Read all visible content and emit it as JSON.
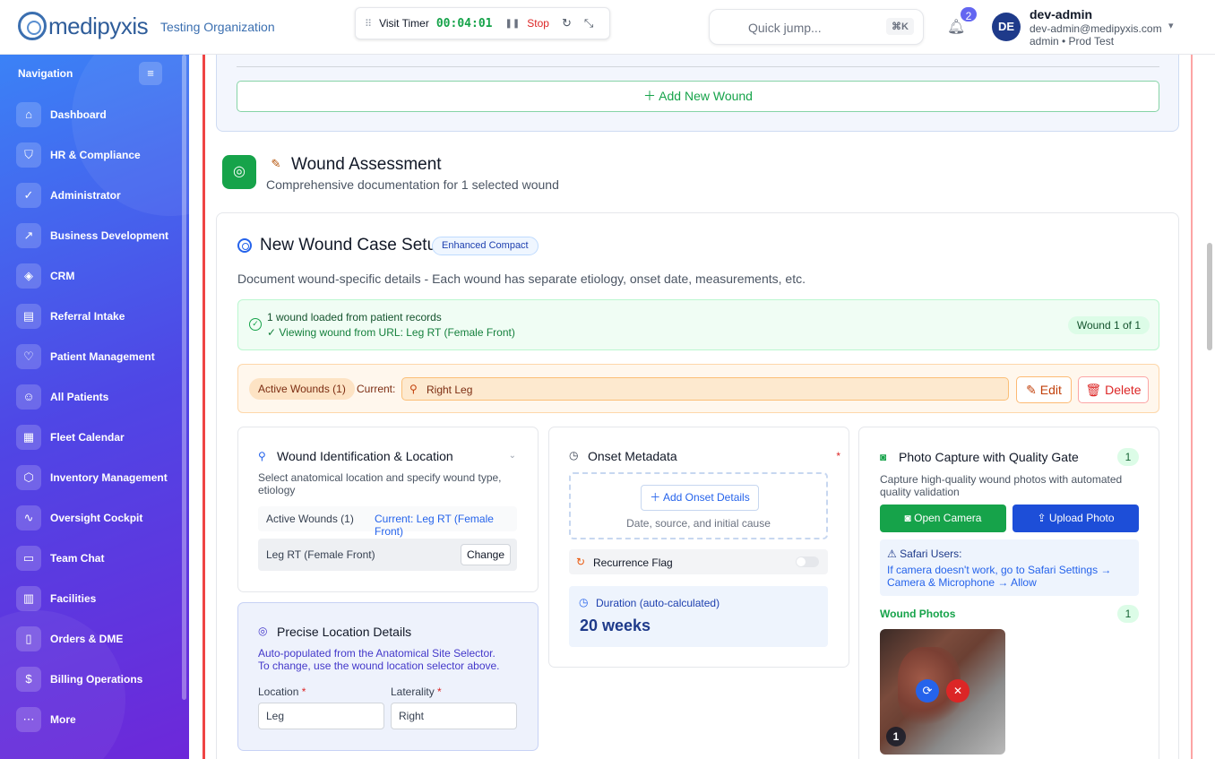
{
  "header": {
    "logo_text": "medipyxis",
    "org_name": "Testing Organization",
    "timer": {
      "label": "Visit Timer",
      "time": "00:04:01",
      "stop_label": "Stop"
    },
    "quick_jump": {
      "placeholder": "Quick jump...",
      "shortcut": "⌘K"
    },
    "notification_count": "2",
    "user": {
      "initials": "DE",
      "name": "dev-admin",
      "email": "dev-admin@medipyxis.com",
      "role": "admin • Prod Test"
    }
  },
  "sidebar": {
    "title": "Navigation",
    "items": [
      {
        "label": "Dashboard",
        "icon": "home-icon"
      },
      {
        "label": "HR & Compliance",
        "icon": "shield-icon"
      },
      {
        "label": "Administrator",
        "icon": "shield-check-icon"
      },
      {
        "label": "Business Development",
        "icon": "trending-up-icon"
      },
      {
        "label": "CRM",
        "icon": "handshake-icon"
      },
      {
        "label": "Referral Intake",
        "icon": "clipboard-icon"
      },
      {
        "label": "Patient Management",
        "icon": "heart-icon"
      },
      {
        "label": "All Patients",
        "icon": "users-icon"
      },
      {
        "label": "Fleet Calendar",
        "icon": "calendar-icon"
      },
      {
        "label": "Inventory Management",
        "icon": "package-icon"
      },
      {
        "label": "Oversight Cockpit",
        "icon": "activity-icon"
      },
      {
        "label": "Team Chat",
        "icon": "message-icon"
      },
      {
        "label": "Facilities",
        "icon": "building-icon"
      },
      {
        "label": "Orders & DME",
        "icon": "document-icon"
      },
      {
        "label": "Billing Operations",
        "icon": "dollar-icon"
      },
      {
        "label": "More",
        "icon": "more-icon"
      }
    ]
  },
  "main": {
    "add_wound_label": "Add New Wound",
    "assessment": {
      "title": "Wound Assessment",
      "subtitle": "Comprehensive documentation for 1 selected wound"
    },
    "case_setup": {
      "title": "New Wound Case Setup",
      "badge": "Enhanced Compact",
      "description": "Document wound-specific details - Each wound has separate etiology, onset date, measurements, etc.",
      "loaded_line1": "1 wound loaded from patient records",
      "loaded_line2": "✓ Viewing wound from URL: Leg RT (Female Front)",
      "wound_of": "Wound 1 of 1",
      "active_chip": "Active Wounds (1)",
      "current_label": "Current:",
      "current_value": "Right Leg",
      "edit_label": "Edit",
      "delete_label": "Delete"
    },
    "identification": {
      "title": "Wound Identification & Location",
      "description": "Select anatomical location and specify wound type, etiology",
      "active_wounds": "Active Wounds (1)",
      "current": "Current: Leg RT (Female Front)",
      "location_text": "Leg RT (Female Front)",
      "change_label": "Change"
    },
    "precise": {
      "title": "Precise Location Details",
      "description": "Auto-populated from the Anatomical Site Selector. To change, use the wound location selector above.",
      "location_label": "Location",
      "location_value": "Leg",
      "laterality_label": "Laterality",
      "laterality_value": "Right"
    },
    "onset": {
      "title": "Onset Metadata",
      "add_label": "Add Onset Details",
      "hint": "Date, source, and initial cause",
      "recurrence_label": "Recurrence Flag",
      "duration_label": "Duration (auto-calculated)",
      "duration_value": "20 weeks"
    },
    "photo": {
      "title": "Photo Capture with Quality Gate",
      "count": "1",
      "description": "Capture high-quality wound photos with automated quality validation",
      "open_camera": "Open Camera",
      "upload_photo": "Upload Photo",
      "safari_title": "Safari Users:",
      "safari_body": "If camera doesn't work, go to Safari Settings → Camera & Microphone → Allow",
      "wound_photos_label": "Wound Photos",
      "wound_photos_count": "1",
      "thumb_number": "1"
    }
  }
}
